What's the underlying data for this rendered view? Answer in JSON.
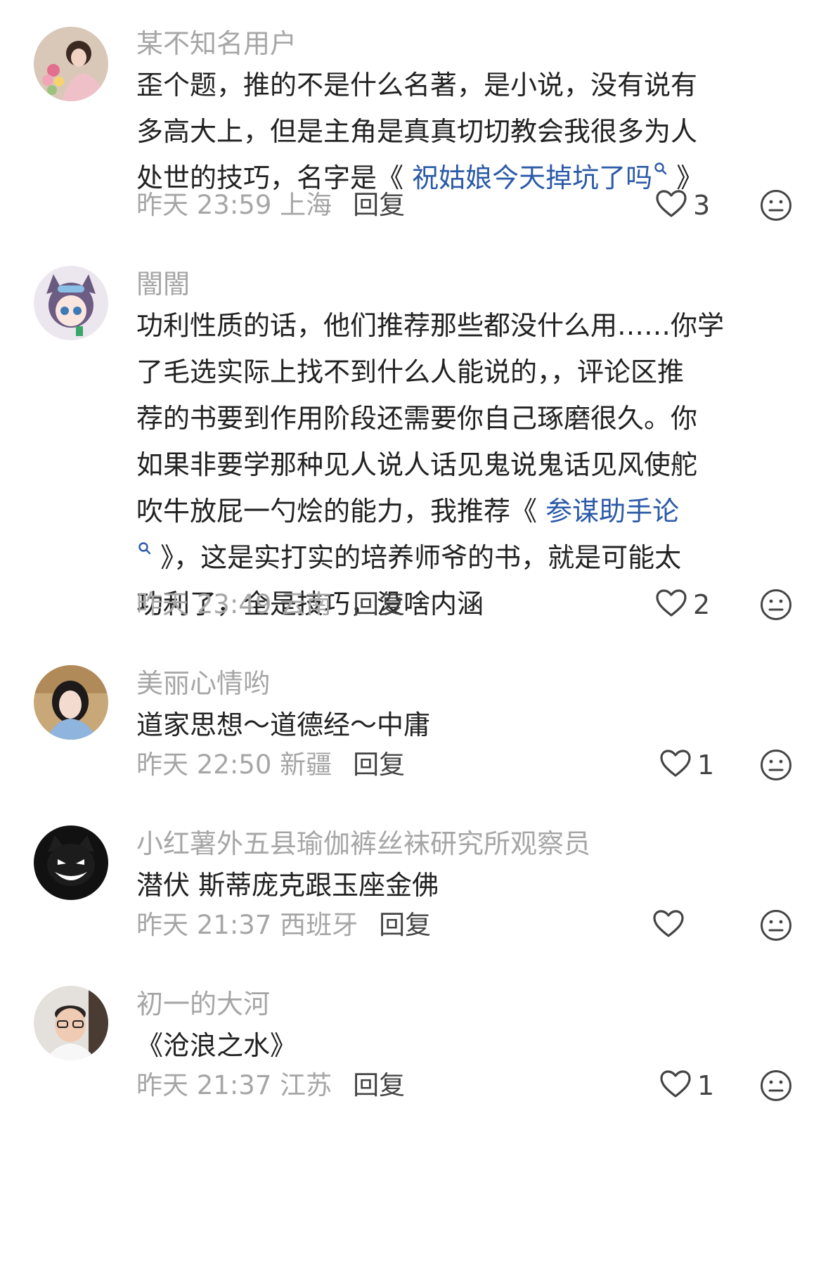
{
  "comments": [
    {
      "username": "某不知名用户",
      "lines": [
        {
          "text": "歪个题，推的不是什么名著，是小说，没有说有"
        },
        {
          "text": "多高大上，但是主角是真真切切教会我很多为人"
        },
        {
          "pre": "处世的技巧，名字是《 ",
          "link": "祝姑娘今天掉坑了吗",
          "post": " 》"
        }
      ],
      "time": "昨天 23:59",
      "location": "上海",
      "reply_label": "回复",
      "likes": "3"
    },
    {
      "username": "闇闇",
      "lines": [
        {
          "text": "功利性质的话，他们推荐那些都没什么用……你学"
        },
        {
          "text": "了毛选实际上找不到什么人能说的，，评论区推"
        },
        {
          "text": "荐的书要到作用阶段还需要你自己琢磨很久。你"
        },
        {
          "text": "如果非要学那种见人说人话见鬼说鬼话见风使舵"
        },
        {
          "pre": "吹牛放屁一勺烩的能力，我推荐《 ",
          "link": "参谋助手论"
        },
        {
          "searchIconLead": true,
          "post": " 》，这是实打实的培养师爷的书，就是可能太"
        },
        {
          "text": "功利了，全是技巧，没啥内涵"
        }
      ],
      "time": "昨天 23:49",
      "location": "云南",
      "reply_label": "回复",
      "likes": "2"
    },
    {
      "username": "美丽心情哟",
      "lines": [
        {
          "text": "道家思想～道德经～中庸"
        }
      ],
      "time": "昨天 22:50",
      "location": "新疆",
      "reply_label": "回复",
      "likes": "1"
    },
    {
      "username": "小红薯外五县瑜伽裤丝袜研究所观察员",
      "lines": [
        {
          "text": "潜伏 斯蒂庞克跟玉座金佛"
        }
      ],
      "time": "昨天 21:37",
      "location": "西班牙",
      "reply_label": "回复",
      "likes": ""
    },
    {
      "username": "初一的大河",
      "lines": [
        {
          "text": "《沧浪之水》"
        }
      ],
      "time": "昨天 21:37",
      "location": "江苏",
      "reply_label": "回复",
      "likes": "1"
    }
  ],
  "icons": {
    "like": "heart-outline-icon",
    "dislike": "neutral-face-icon",
    "search": "search-icon"
  },
  "colors": {
    "username": "#a6a6a6",
    "text": "#222222",
    "link": "#2b5aa8",
    "meta": "#a6a6a6",
    "icon": "#444444"
  }
}
